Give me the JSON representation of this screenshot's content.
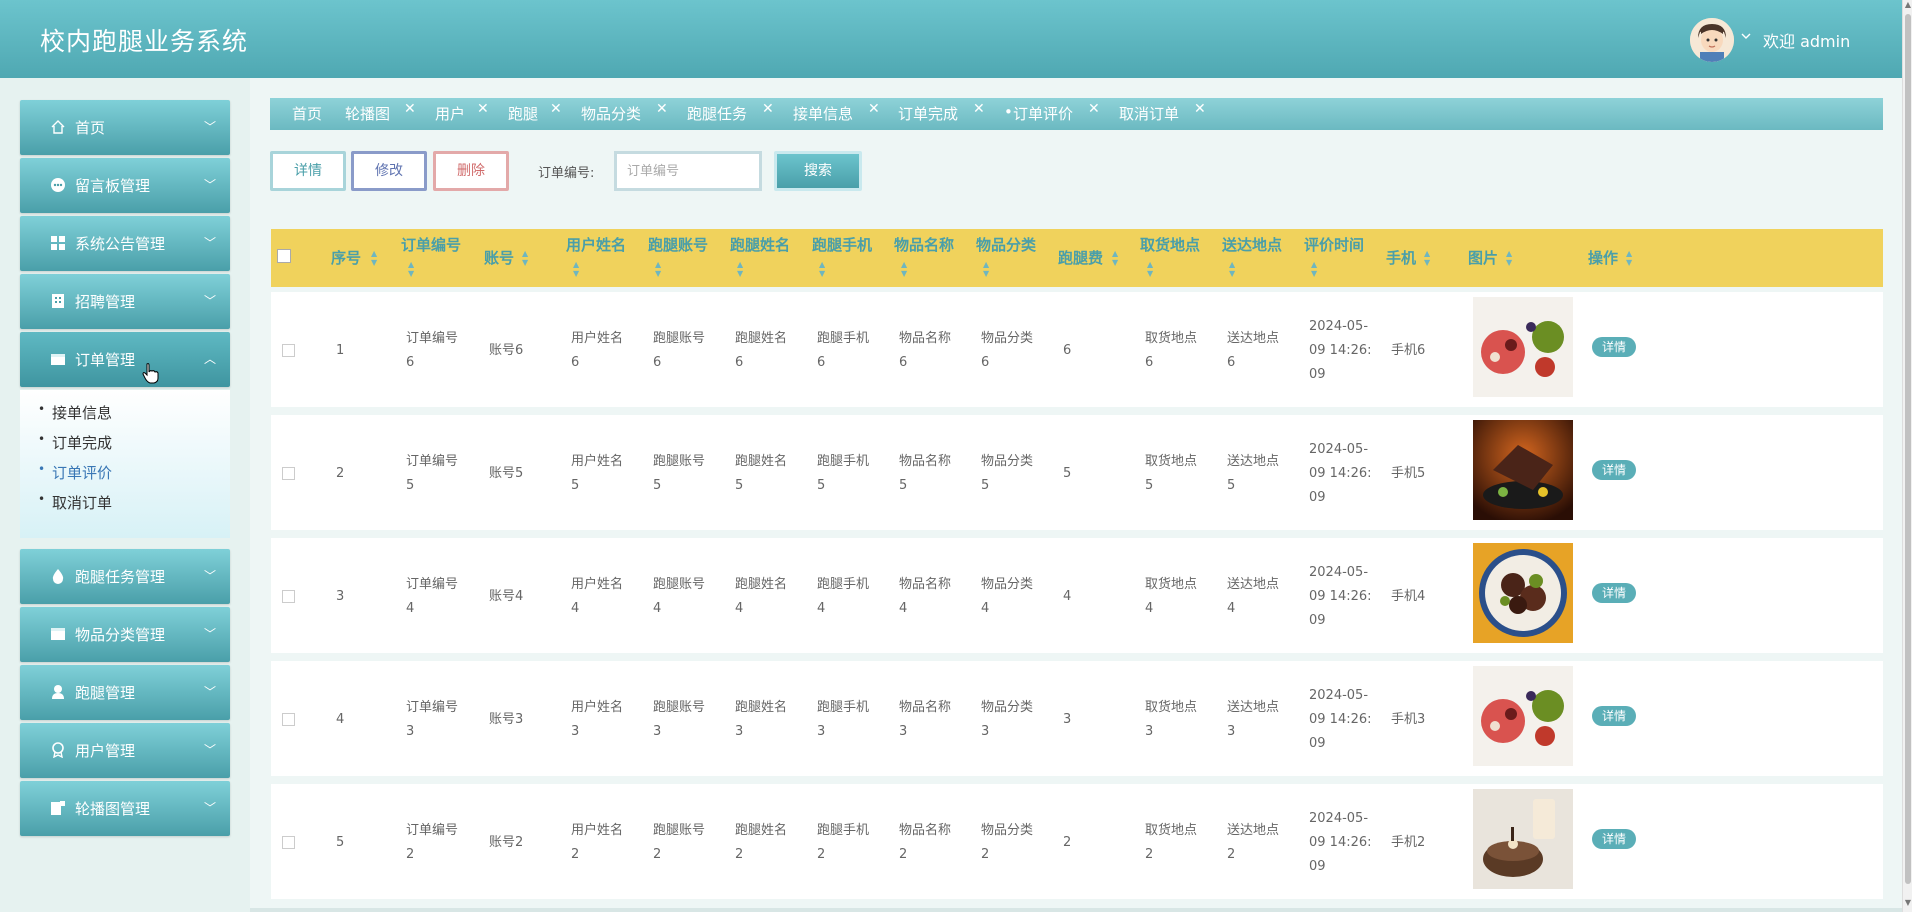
{
  "app": {
    "title": "校内跑腿业务系统",
    "welcome": "欢迎 admin"
  },
  "sidebar": {
    "items": [
      {
        "label": "首页",
        "icon": "home-icon"
      },
      {
        "label": "留言板管理",
        "icon": "message-icon"
      },
      {
        "label": "系统公告管理",
        "icon": "grid-icon"
      },
      {
        "label": "招聘管理",
        "icon": "building-icon"
      },
      {
        "label": "订单管理",
        "icon": "wallet-icon"
      },
      {
        "label": "跑腿任务管理",
        "icon": "drop-icon"
      },
      {
        "label": "物品分类管理",
        "icon": "card-icon"
      },
      {
        "label": "跑腿管理",
        "icon": "user-icon"
      },
      {
        "label": "用户管理",
        "icon": "badge-icon"
      },
      {
        "label": "轮播图管理",
        "icon": "image-icon"
      }
    ],
    "submenu": [
      "接单信息",
      "订单完成",
      "订单评价",
      "取消订单"
    ],
    "current_sub": "订单评价"
  },
  "tabs": [
    "首页",
    "轮播图",
    "用户",
    "跑腿",
    "物品分类",
    "跑腿任务",
    "接单信息",
    "订单完成",
    "订单评价",
    "取消订单"
  ],
  "toolbar": {
    "detail": "详情",
    "edit": "修改",
    "delete": "删除",
    "order_label": "订单编号:",
    "order_placeholder": "订单编号",
    "search": "搜索"
  },
  "table": {
    "headers": [
      "序号",
      "订单编号",
      "账号",
      "用户姓名",
      "跑腿账号",
      "跑腿姓名",
      "跑腿手机",
      "物品名称",
      "物品分类",
      "跑腿费",
      "取货地点",
      "送达地点",
      "评价时间",
      "手机",
      "图片",
      "操作"
    ],
    "rows": [
      {
        "no": "1",
        "order": [
          "订单编号",
          "6"
        ],
        "account": "账号6",
        "uname": [
          "用户姓名",
          "6"
        ],
        "racc": [
          "跑腿账号",
          "6"
        ],
        "rname": [
          "跑腿姓名",
          "6"
        ],
        "rphone": [
          "跑腿手机",
          "6"
        ],
        "item": [
          "物品名称",
          "6"
        ],
        "cat": [
          "物品分类",
          "6"
        ],
        "fee": "6",
        "pick": [
          "取货地点",
          "6"
        ],
        "dest": [
          "送达地点",
          "6"
        ],
        "time": [
          "2024-05-",
          "09 14:26:",
          "09"
        ],
        "phone": "手机6",
        "image": "fruit"
      },
      {
        "no": "2",
        "order": [
          "订单编号",
          "5"
        ],
        "account": "账号5",
        "uname": [
          "用户姓名",
          "5"
        ],
        "racc": [
          "跑腿账号",
          "5"
        ],
        "rname": [
          "跑腿姓名",
          "5"
        ],
        "rphone": [
          "跑腿手机",
          "5"
        ],
        "item": [
          "物品名称",
          "5"
        ],
        "cat": [
          "物品分类",
          "5"
        ],
        "fee": "5",
        "pick": [
          "取货地点",
          "5"
        ],
        "dest": [
          "送达地点",
          "5"
        ],
        "time": [
          "2024-05-",
          "09 14:26:",
          "09"
        ],
        "phone": "手机5",
        "image": "meat-dark"
      },
      {
        "no": "3",
        "order": [
          "订单编号",
          "4"
        ],
        "account": "账号4",
        "uname": [
          "用户姓名",
          "4"
        ],
        "racc": [
          "跑腿账号",
          "4"
        ],
        "rname": [
          "跑腿姓名",
          "4"
        ],
        "rphone": [
          "跑腿手机",
          "4"
        ],
        "item": [
          "物品名称",
          "4"
        ],
        "cat": [
          "物品分类",
          "4"
        ],
        "fee": "4",
        "pick": [
          "取货地点",
          "4"
        ],
        "dest": [
          "送达地点",
          "4"
        ],
        "time": [
          "2024-05-",
          "09 14:26:",
          "09"
        ],
        "phone": "手机4",
        "image": "meat-bowl"
      },
      {
        "no": "4",
        "order": [
          "订单编号",
          "3"
        ],
        "account": "账号3",
        "uname": [
          "用户姓名",
          "3"
        ],
        "racc": [
          "跑腿账号",
          "3"
        ],
        "rname": [
          "跑腿姓名",
          "3"
        ],
        "rphone": [
          "跑腿手机",
          "3"
        ],
        "item": [
          "物品名称",
          "3"
        ],
        "cat": [
          "物品分类",
          "3"
        ],
        "fee": "3",
        "pick": [
          "取货地点",
          "3"
        ],
        "dest": [
          "送达地点",
          "3"
        ],
        "time": [
          "2024-05-",
          "09 14:26:",
          "09"
        ],
        "phone": "手机3",
        "image": "fruit"
      },
      {
        "no": "5",
        "order": [
          "订单编号",
          "2"
        ],
        "account": "账号2",
        "uname": [
          "用户姓名",
          "2"
        ],
        "racc": [
          "跑腿账号",
          "2"
        ],
        "rname": [
          "跑腿姓名",
          "2"
        ],
        "rphone": [
          "跑腿手机",
          "2"
        ],
        "item": [
          "物品名称",
          "2"
        ],
        "cat": [
          "物品分类",
          "2"
        ],
        "fee": "2",
        "pick": [
          "取货地点",
          "2"
        ],
        "dest": [
          "送达地点",
          "2"
        ],
        "time": [
          "2024-05-",
          "09 14:26:",
          "09"
        ],
        "phone": "手机2",
        "image": "cake"
      }
    ],
    "action_label": "详情"
  },
  "colors": {
    "header": "#5ab5bf",
    "table_head": "#f0d25c",
    "accent": "#4a9fa9"
  }
}
